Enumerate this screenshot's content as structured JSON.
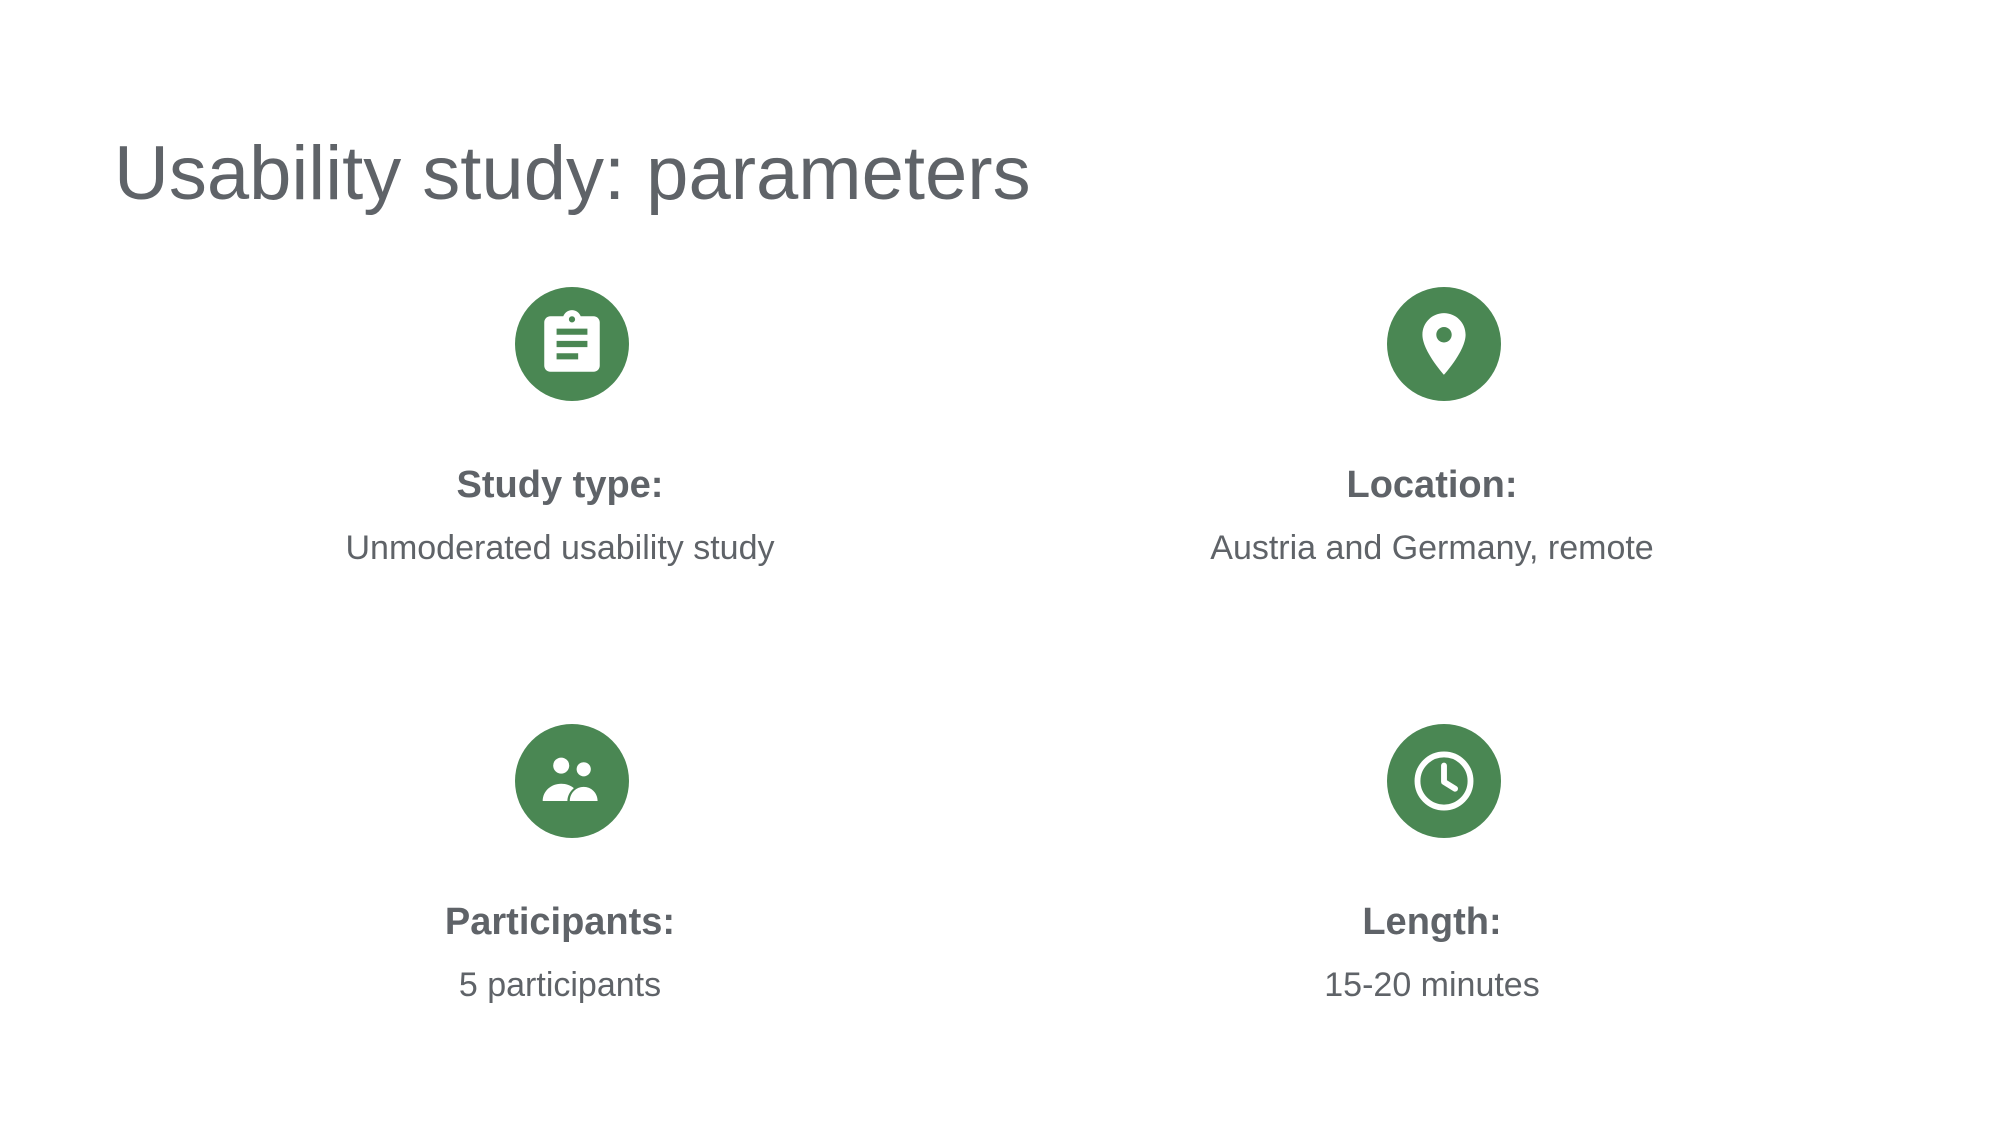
{
  "title": "Usability study: parameters",
  "colors": {
    "accent": "#4a8753",
    "text": "#5f6368",
    "background": "#ffffff"
  },
  "parameters": [
    {
      "icon": "clipboard-icon",
      "label": "Study type:",
      "value": "Unmoderated usability study"
    },
    {
      "icon": "location-pin-icon",
      "label": "Location:",
      "value": "Austria and Germany, remote"
    },
    {
      "icon": "people-icon",
      "label": "Participants:",
      "value": "5 participants"
    },
    {
      "icon": "clock-icon",
      "label": "Length:",
      "value": "15-20 minutes"
    }
  ]
}
